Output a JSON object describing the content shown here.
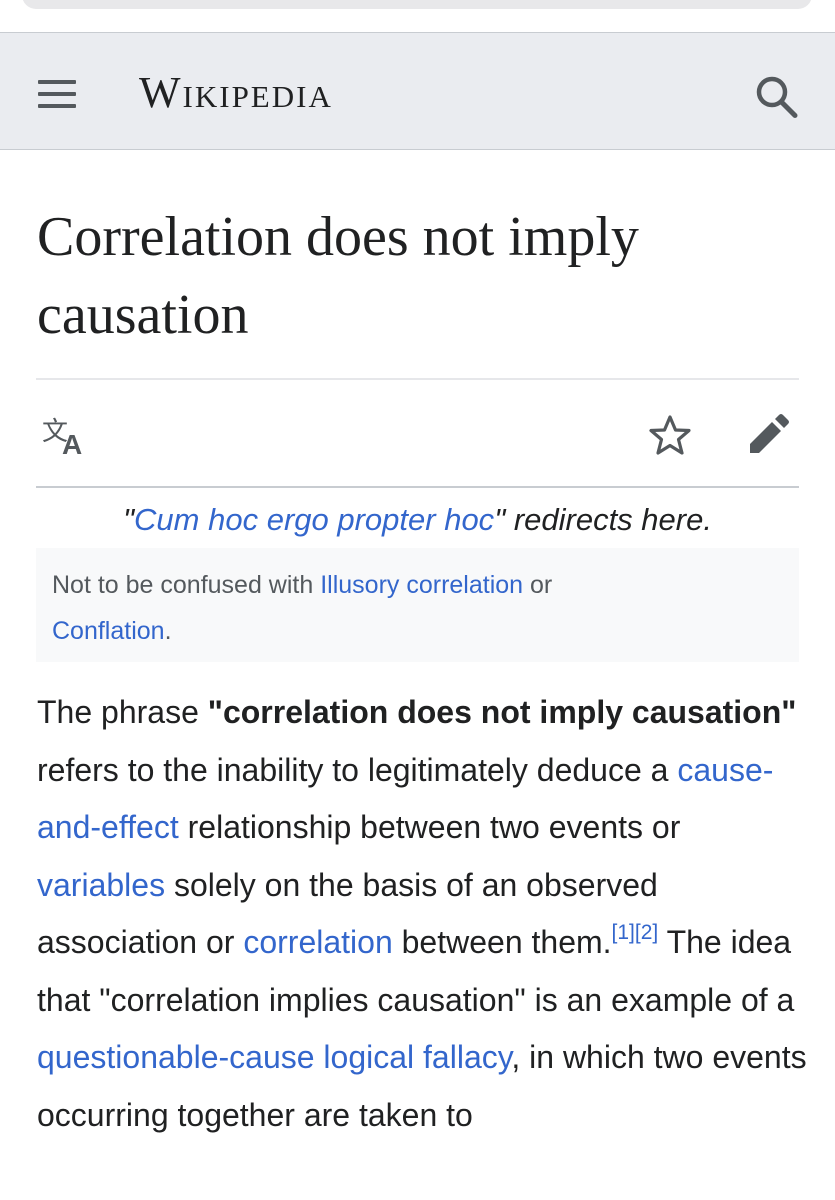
{
  "header": {
    "wordmark": "Wikipedia",
    "menu_icon": "hamburger-menu-icon",
    "search_icon": "search-icon",
    "background": "#eaecf0"
  },
  "article": {
    "title": "Correlation does not imply causation"
  },
  "page_actions": {
    "language_icon": "language-icon",
    "watch_icon": "star-icon",
    "edit_icon": "pencil-icon"
  },
  "hatnote_redirect": {
    "quote_open": "\"",
    "link": "Cum hoc ergo propter hoc",
    "quote_close": "\"",
    "suffix": " redirects here."
  },
  "hatnote_confusion": {
    "prefix": "Not to be confused with ",
    "link1": "Illusory correlation",
    "middle": " or",
    "link2": "Conflation",
    "suffix": "."
  },
  "body": {
    "t1": "The phrase ",
    "bold": "\"correlation does not imply causation\"",
    "t2": " refers to the inability to legitimately deduce a ",
    "link1": "cause-and-effect",
    "t3": " relationship between two events or ",
    "link2": "variables",
    "t4": " solely on the basis of an observed association or ",
    "link3": "correlation",
    "t5": " between them.",
    "ref1": "[1]",
    "ref2": "[2]",
    "t6": " The idea that \"correlation implies causation\" is an example of a ",
    "link4": "questionable-cause logical fallacy",
    "t7": ", in which two events occurring together are taken to"
  },
  "colors": {
    "link": "#3366cc",
    "text": "#202122",
    "icon": "#54595d"
  }
}
